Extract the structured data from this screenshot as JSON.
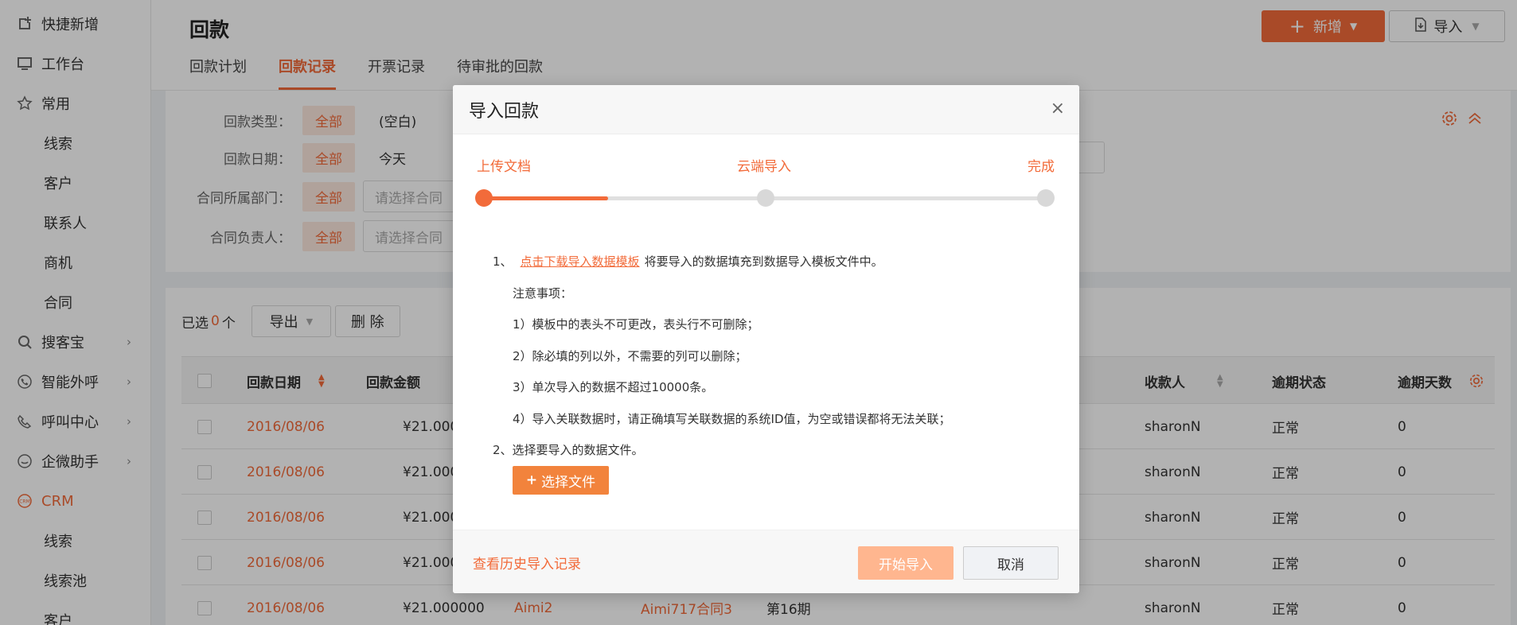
{
  "sidebar": {
    "items": [
      {
        "label": "快捷新增",
        "icon": "add-square-icon"
      },
      {
        "label": "工作台",
        "icon": "monitor-icon"
      },
      {
        "label": "常用",
        "icon": "star-icon"
      }
    ],
    "common_sub": [
      "线索",
      "客户",
      "联系人",
      "商机",
      "合同"
    ],
    "groups": [
      {
        "label": "搜客宝",
        "icon": "search-icon"
      },
      {
        "label": "智能外呼",
        "icon": "phone-icon"
      },
      {
        "label": "呼叫中心",
        "icon": "call-icon"
      },
      {
        "label": "企微助手",
        "icon": "wechat-icon"
      }
    ],
    "crm": {
      "label": "CRM",
      "icon": "crm-icon"
    },
    "crm_sub": [
      "线索",
      "线索池",
      "客户"
    ]
  },
  "header": {
    "title": "回款",
    "tabs": [
      "回款计划",
      "回款记录",
      "开票记录",
      "待审批的回款"
    ],
    "active_tab": "回款记录",
    "new_button": "新增",
    "import_button": "导入"
  },
  "filters": {
    "type_label": "回款类型：",
    "date_label": "回款日期：",
    "dept_label": "合同所属部门：",
    "owner_label": "合同负责人：",
    "all": "全部",
    "blank": "(空白)",
    "today": "今天",
    "select_placeholder": "请选择合同"
  },
  "table": {
    "selected_prefix": "已选",
    "selected_count": "0",
    "selected_suffix": "个",
    "export": "导出",
    "delete": "删 除",
    "columns": [
      "回款日期",
      "回款金额",
      "收款人",
      "逾期状态",
      "逾期天数"
    ],
    "rows": [
      {
        "date": "2016/08/06",
        "amount": "¥21.00000",
        "customer": "",
        "contract": "",
        "period": "",
        "payee": "sharonN",
        "status": "正常",
        "days": "0"
      },
      {
        "date": "2016/08/06",
        "amount": "¥21.00000",
        "customer": "",
        "contract": "",
        "period": "",
        "payee": "sharonN",
        "status": "正常",
        "days": "0"
      },
      {
        "date": "2016/08/06",
        "amount": "¥21.00000",
        "customer": "",
        "contract": "",
        "period": "",
        "payee": "sharonN",
        "status": "正常",
        "days": "0"
      },
      {
        "date": "2016/08/06",
        "amount": "¥21.00000",
        "customer": "",
        "contract": "",
        "period": "",
        "payee": "sharonN",
        "status": "正常",
        "days": "0"
      },
      {
        "date": "2016/08/06",
        "amount": "¥21.000000",
        "customer": "Aimi2",
        "contract": "Aimi717合同3",
        "period": "第16期",
        "payee": "sharonN",
        "status": "正常",
        "days": "0"
      }
    ]
  },
  "modal": {
    "title": "导入回款",
    "close": "×",
    "steps": [
      "上传文档",
      "云端导入",
      "完成"
    ],
    "progress": 0.22,
    "step1_prefix": "1、",
    "step1_link": "点击下载导入数据模板",
    "step1_suffix": "将要导入的数据填充到数据导入模板文件中。",
    "notes_title": "注意事项：",
    "notes": [
      "1）模板中的表头不可更改，表头行不可删除；",
      "2）除必填的列以外，不需要的列可以删除；",
      "3）单次导入的数据不超过10000条。",
      "4）导入关联数据时，请正确填写关联数据的系统ID值，为空或错误都将无法关联；"
    ],
    "step2": "2、选择要导入的数据文件。",
    "choose_file": "选择文件",
    "history": "查看历史导入记录",
    "start": "开始导入",
    "cancel": "取消"
  },
  "colors": {
    "accent": "#f26b3a",
    "accent_light": "#ffb68f"
  }
}
